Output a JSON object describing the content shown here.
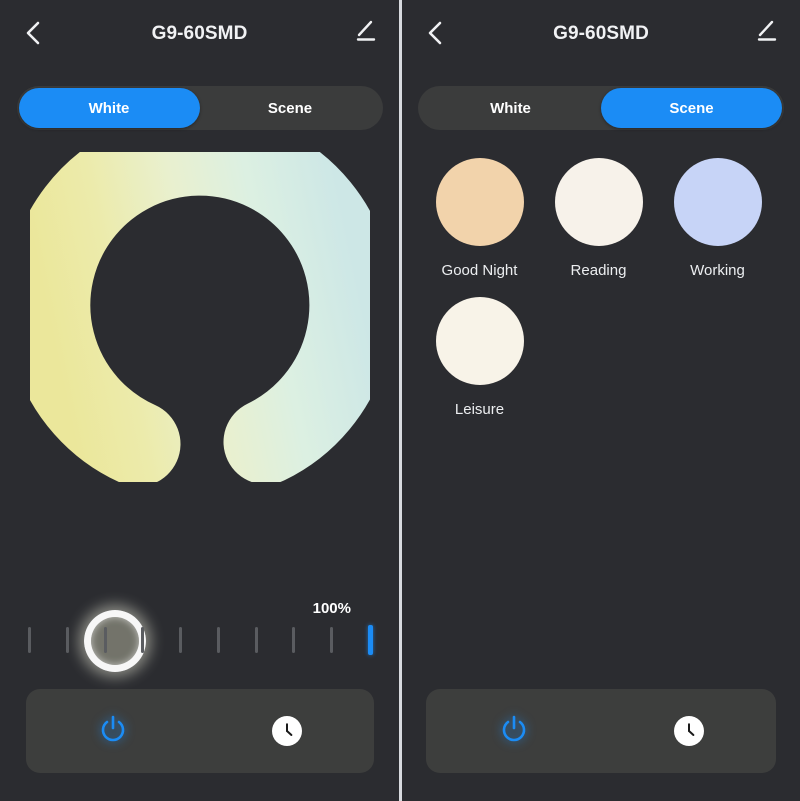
{
  "app": {
    "background_color": "#2b2c30",
    "accent_color": "#1b8cf5",
    "bar_color": "#3d3e3d"
  },
  "left_panel": {
    "header": {
      "title": "G9-60SMD",
      "back_icon": "chevron-left-icon",
      "edit_icon": "pencil-edit-icon"
    },
    "tabs": [
      {
        "label": "White",
        "active": true
      },
      {
        "label": "Scene",
        "active": false
      }
    ],
    "color_ring": {
      "name": "color-temperature-ring",
      "warm_color": "#f0efa8",
      "mid_color": "#e8f0dc",
      "cool_color": "#cfe6e4",
      "handle_position_deg": 205,
      "gap_direction": "bottom"
    },
    "brightness": {
      "value_label": "100%",
      "value": 100,
      "tick_count": 10,
      "active_tick_index": 9
    },
    "bottom_bar": {
      "power_label": "power-icon",
      "timer_label": "timer-clock-icon"
    }
  },
  "right_panel": {
    "header": {
      "title": "G9-60SMD",
      "back_icon": "chevron-left-icon",
      "edit_icon": "pencil-edit-icon"
    },
    "tabs": [
      {
        "label": "White",
        "active": false
      },
      {
        "label": "Scene",
        "active": true
      }
    ],
    "scenes": [
      {
        "label": "Good Night",
        "color": "#f2d3ab"
      },
      {
        "label": "Reading",
        "color": "#f7f2ea"
      },
      {
        "label": "Working",
        "color": "#c7d4f7"
      },
      {
        "label": "Leisure",
        "color": "#f8f3e8"
      }
    ],
    "bottom_bar": {
      "power_label": "power-icon",
      "timer_label": "timer-clock-icon"
    }
  }
}
